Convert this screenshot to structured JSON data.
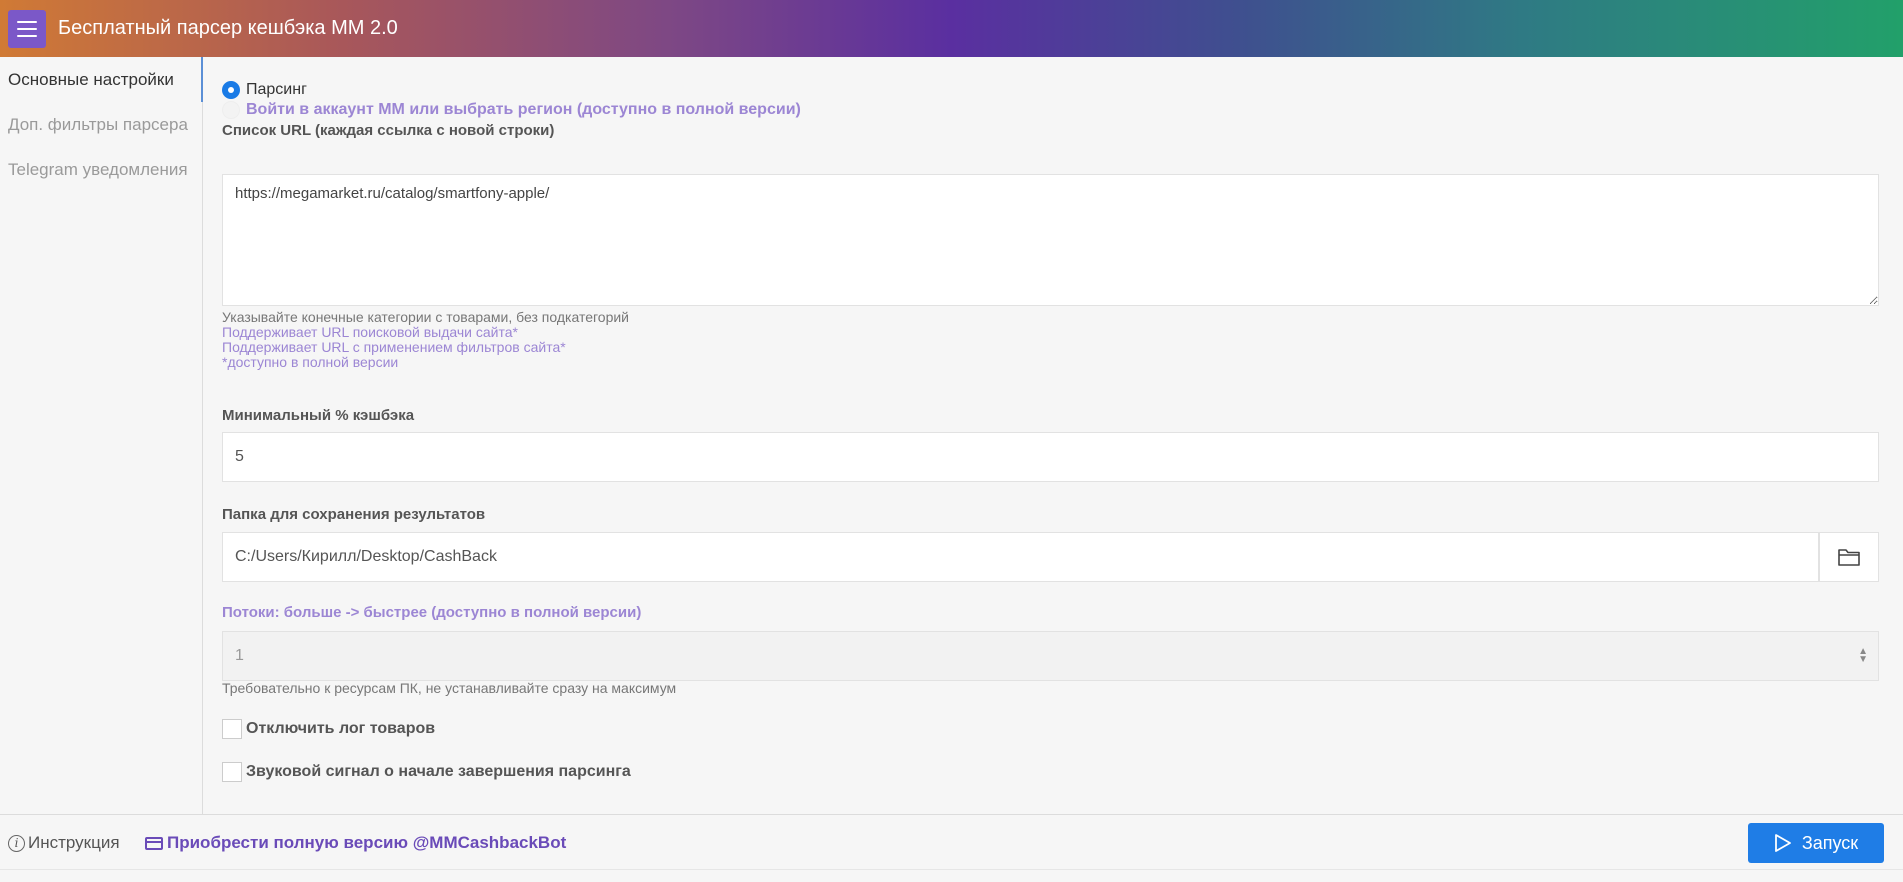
{
  "header": {
    "title": "Бесплатный парсер кешбэка ММ 2.0"
  },
  "sidebar": {
    "items": [
      {
        "label": "Основные настройки"
      },
      {
        "label": "Доп. фильтры парсера"
      },
      {
        "label": "Telegram уведомления"
      }
    ]
  },
  "mode": {
    "option_parsing": "Парсинг",
    "option_login": "Войти в аккаунт ММ или выбрать регион (доступно в полной версии)",
    "selected": "Парсинг"
  },
  "urls": {
    "label": "Список URL (каждая ссылка с новой строки)",
    "value": "https://megamarket.ru/catalog/smartfony-apple/",
    "hint1": "Указывайте конечные категории с товарами, без подкатегорий",
    "hint2": "Поддерживает URL поисковой выдачи сайта*",
    "hint3": "Поддерживает URL с применением фильтров сайта*",
    "hint4": "*доступно в полной версии"
  },
  "cashback": {
    "label": "Минимальный % кэшбэка",
    "value": "5"
  },
  "folder": {
    "label": "Папка для сохранения результатов",
    "value": "C:/Users/Кирилл/Desktop/CashBack"
  },
  "threads": {
    "label": "Потоки: больше -> быстрее (доступно в полной версии)",
    "value": "1",
    "hint": "Требовательно к ресурсам ПК, не устанавливайте сразу на максимум"
  },
  "options": {
    "disable_log": "Отключить лог товаров",
    "sound_signal": "Звуковой сигнал о начале завершения парсинга"
  },
  "footer": {
    "instructions": "Инструкция",
    "buy_full": "Приобрести полную версию @MMCashbackBot",
    "run": "Запуск"
  },
  "colors": {
    "accent_blue": "#1f7de6",
    "purple": "#9c86d4",
    "link_purple": "#6a4bb8"
  }
}
